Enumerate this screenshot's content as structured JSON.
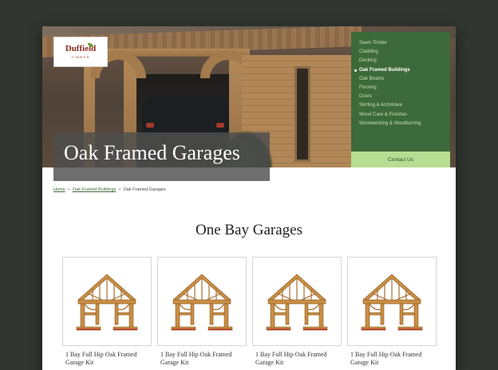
{
  "brand": {
    "name": "Duffield",
    "tagline": "TIMBER"
  },
  "hero": {
    "title": "Oak Framed Garages"
  },
  "menu": {
    "items": [
      {
        "label": "Sawn Timber",
        "active": false
      },
      {
        "label": "Cladding",
        "active": false
      },
      {
        "label": "Decking",
        "active": false
      },
      {
        "label": "Oak Framed Buildings",
        "active": true
      },
      {
        "label": "Oak Beams",
        "active": false
      },
      {
        "label": "Flooring",
        "active": false
      },
      {
        "label": "Doors",
        "active": false
      },
      {
        "label": "Skirting & Architrave",
        "active": false
      },
      {
        "label": "Wood Care & Finishes",
        "active": false
      },
      {
        "label": "Woodworking & Woodturning",
        "active": false
      }
    ],
    "contact_label": "Contact Us"
  },
  "breadcrumb": {
    "home": "Home",
    "sep1": ">",
    "parent": "Oak Framed Buildings",
    "sep2": ">",
    "current": "Oak Framed Garages"
  },
  "section": {
    "title": "One Bay Garages"
  },
  "products": [
    {
      "name": "1 Bay Full Hip Oak Framed Garage Kit"
    },
    {
      "name": "1 Bay Full Hip Oak Framed Garage Kit"
    },
    {
      "name": "1 Bay Full Hip Oak Framed Garage Kit"
    },
    {
      "name": "1 Bay Full Hip Oak Framed Garage Kit"
    }
  ],
  "colors": {
    "menu_bg": "#3d6a3a",
    "contact_bg": "#b6dd91",
    "page_bg": "#313631",
    "brand_red": "#8a2a1c"
  }
}
